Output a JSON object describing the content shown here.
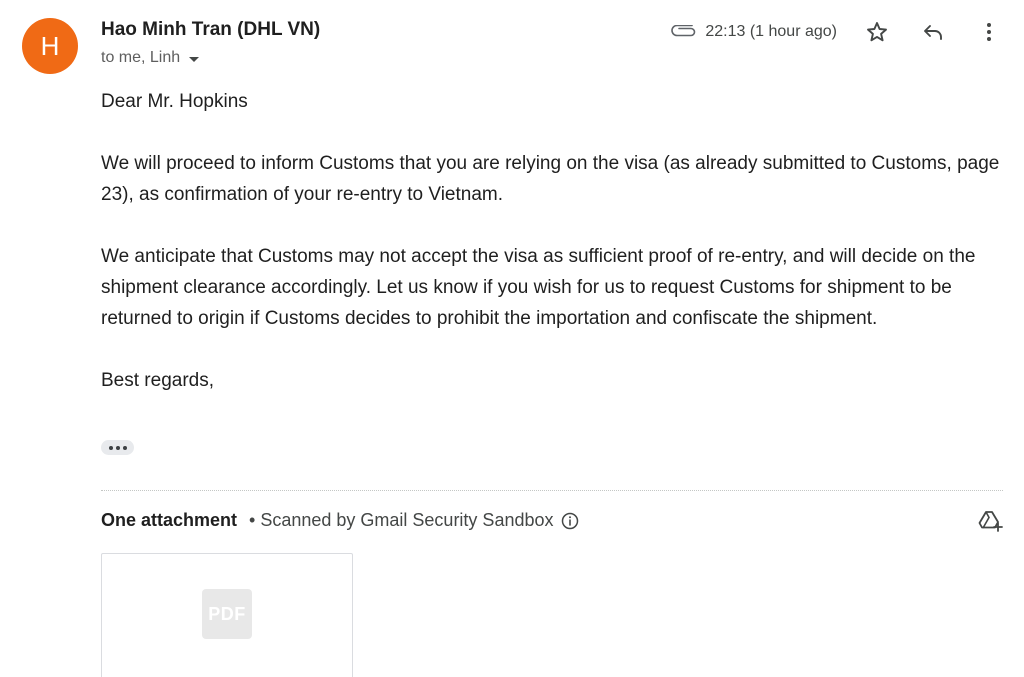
{
  "email": {
    "sender": {
      "initial": "H",
      "name": "Hao Minh Tran (DHL VN)",
      "avatar_color": "#f06a15"
    },
    "recipients": "to me, Linh",
    "timestamp": "22:13 (1 hour ago)",
    "icons": {
      "attachment": "paperclip-icon",
      "star": "star-icon",
      "reply": "reply-icon",
      "more": "more-vert-icon"
    },
    "body": {
      "greeting": "Dear Mr. Hopkins",
      "paragraphs": [
        "We will proceed to inform Customs that you are relying on the visa (as already submitted to Customs, page 23), as confirmation of your re-entry to Vietnam.",
        "We anticipate that Customs may not accept the visa as sufficient proof of re-entry, and will decide on the shipment clearance accordingly.  Let us know if you wish for us to request Customs for shipment to be returned to origin if Customs decides to prohibit the importation and confiscate the shipment."
      ],
      "signoff": "Best regards,"
    },
    "attachments": {
      "title": "One attachment",
      "scan_note": "• Scanned by Gmail Security Sandbox",
      "file_type_badge": "PDF"
    }
  }
}
